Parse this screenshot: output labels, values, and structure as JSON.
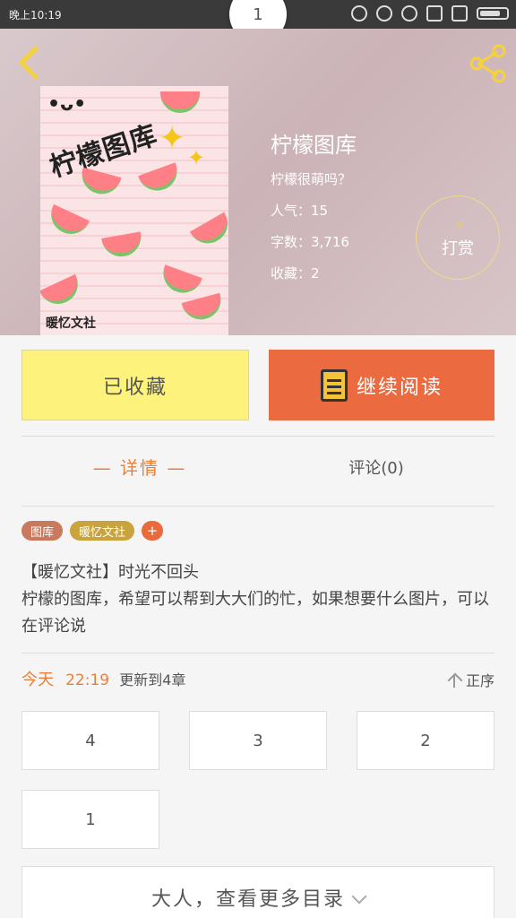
{
  "status_bar": {
    "time": "晚上10:19",
    "notch": "1"
  },
  "book": {
    "title": "柠檬图库",
    "subtitle": "柠檬很萌吗？",
    "popularity": "人气：15",
    "word_count": "字数：3,716",
    "favorites": "收藏：2",
    "cover": {
      "face": "•ᴗ•",
      "title": "柠檬图库",
      "publisher": "暖忆文社"
    }
  },
  "reward": {
    "label": "打赏"
  },
  "actions": {
    "favorited_label": "已收藏",
    "continue_label": "继续阅读"
  },
  "tabs": {
    "detail": "— 详情 —",
    "comment": "评论(0)"
  },
  "tags": [
    "图库",
    "暖忆文社",
    "+"
  ],
  "description": {
    "line1": "【暖忆文社】时光不回头",
    "line2": "柠檬的图库，希望可以帮到大大们的忙，如果想要什么图片，可以在评论说"
  },
  "update": {
    "today": "今天",
    "time": "22:19",
    "text": "更新到4章",
    "sort": "正序"
  },
  "chapters": [
    "4",
    "3",
    "2",
    "1"
  ],
  "more": {
    "label": "大人，查看更多目录"
  },
  "colors": {
    "accent": "#ec6a3f",
    "fav_yellow": "#fdf27c",
    "header_bg": "#cfb9bc"
  },
  "icons": [
    "back-icon",
    "share-icon",
    "book-icon",
    "sort-arrow-icon",
    "chevron-down-icon"
  ]
}
